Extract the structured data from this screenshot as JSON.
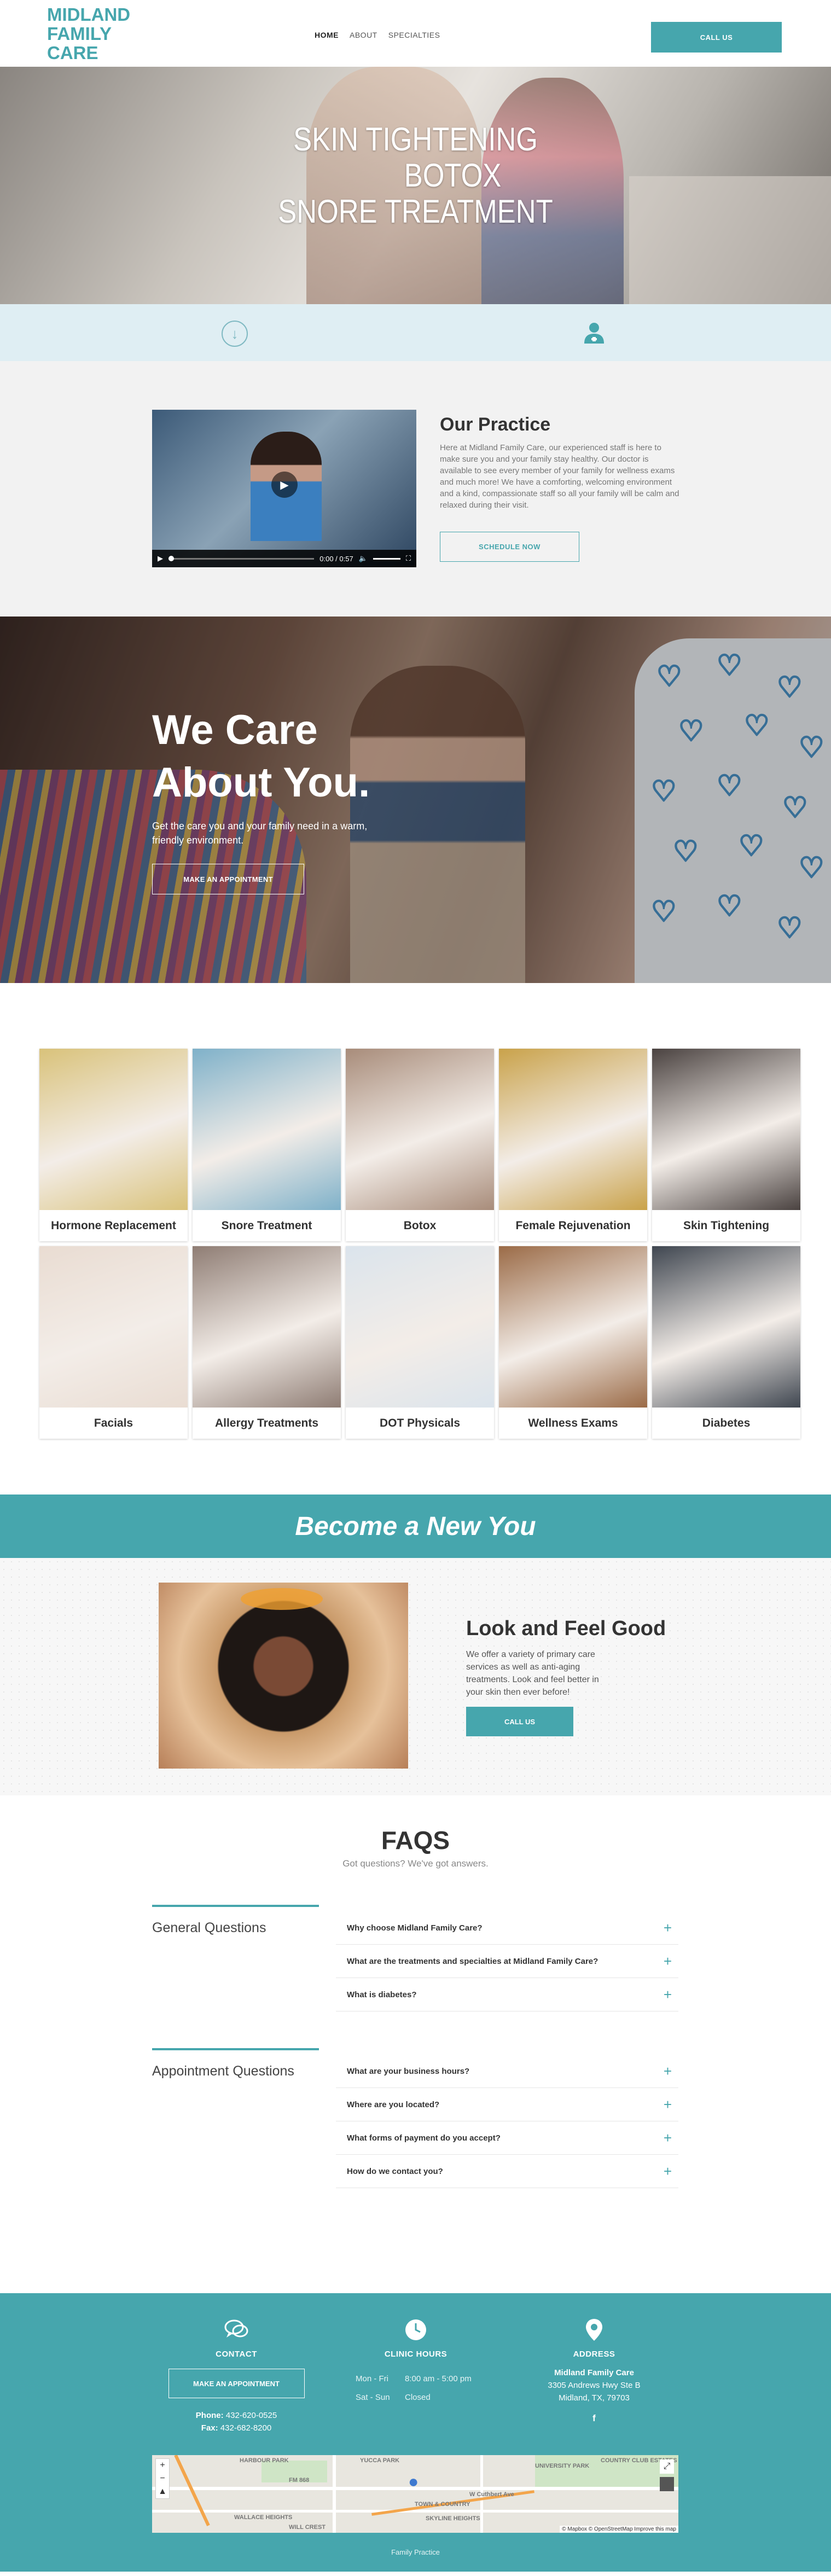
{
  "header": {
    "logo_lines": [
      "MIDLAND",
      "FAMILY",
      "CARE"
    ],
    "nav": [
      "HOME",
      "ABOUT",
      "SPECIALTIES"
    ],
    "call_button": "CALL US"
  },
  "hero": {
    "lines": [
      "SKIN TIGHTENING",
      "BOTOX",
      "SNORE TREATMENT"
    ]
  },
  "icon_bar": {
    "left_icon": "arrow-down-circle-icon",
    "right_icon": "doctor-icon"
  },
  "practice": {
    "title": "Our Practice",
    "text": "Here at Midland Family Care, our experienced staff is here to make sure you and your family stay healthy. Our doctor is available to see every member of your family for wellness exams and much more! We have a comforting, welcoming environment and a kind, compassionate staff so all your family will be calm and relaxed during their visit.",
    "button": "SCHEDULE NOW",
    "video": {
      "time": "0:00 / 0:57"
    }
  },
  "care": {
    "title_lines": [
      "We Care",
      "About You."
    ],
    "text": "Get the care you and your family need in a warm, friendly environment.",
    "button": "MAKE AN APPOINTMENT"
  },
  "services": [
    {
      "label": "Hormone Replacement",
      "color": "#d9c27a"
    },
    {
      "label": "Snore Treatment",
      "color": "#7fb1c9"
    },
    {
      "label": "Botox",
      "color": "#a88c7a"
    },
    {
      "label": "Female Rejuvenation",
      "color": "#c9a24a"
    },
    {
      "label": "Skin Tightening",
      "color": "#4a4240"
    },
    {
      "label": "Facials",
      "color": "#e9dcd2"
    },
    {
      "label": "Allergy Treatments",
      "color": "#8f7d74"
    },
    {
      "label": "DOT Physicals",
      "color": "#dbe4ec"
    },
    {
      "label": "Wellness Exams",
      "color": "#9b6b47"
    },
    {
      "label": "Diabetes",
      "color": "#3f4650"
    }
  ],
  "become": {
    "title": "Become a New You"
  },
  "look": {
    "title": "Look and Feel Good",
    "text": "We offer a variety of primary care services as well as anti-aging treatments. Look and feel better in your skin then ever before!",
    "button": "CALL US"
  },
  "faq": {
    "title": "FAQS",
    "subtitle": "Got questions? We've got answers.",
    "groups": [
      {
        "title": "General Questions",
        "items": [
          "Why choose Midland Family Care?",
          "What are the treatments and specialties at Midland Family Care?",
          "What is diabetes?"
        ]
      },
      {
        "title": "Appointment Questions",
        "items": [
          "What are your business hours?",
          "Where are you located?",
          "What forms of payment do you accept?",
          "How do we contact you?"
        ]
      }
    ]
  },
  "footer": {
    "contact": {
      "title": "CONTACT",
      "button": "MAKE AN APPOINTMENT",
      "phone_label": "Phone:",
      "phone": "432-620-0525",
      "fax_label": "Fax:",
      "fax": "432-682-8200"
    },
    "hours": {
      "title": "CLINIC HOURS",
      "rows": [
        {
          "days": "Mon - Fri",
          "time": "8:00 am - 5:00 pm"
        },
        {
          "days": "Sat - Sun",
          "time": "Closed"
        }
      ]
    },
    "address": {
      "title": "ADDRESS",
      "name": "Midland Family Care",
      "line1": "3305 Andrews Hwy Ste B",
      "line2": "Midland, TX, 79703",
      "social": "f"
    },
    "map": {
      "labels": [
        "HARBOUR PARK",
        "YUCCA PARK",
        "UNIVERSITY PARK",
        "COUNTRY CLUB ESTATES",
        "WALLACE HEIGHTS",
        "SKYLINE HEIGHTS",
        "TOWN & COUNTRY",
        "FM 868",
        "W Cuthbert Ave",
        "WILL CREST"
      ],
      "attribution": "© Mapbox © OpenStreetMap Improve this map"
    },
    "copyright": "Family Practice"
  }
}
